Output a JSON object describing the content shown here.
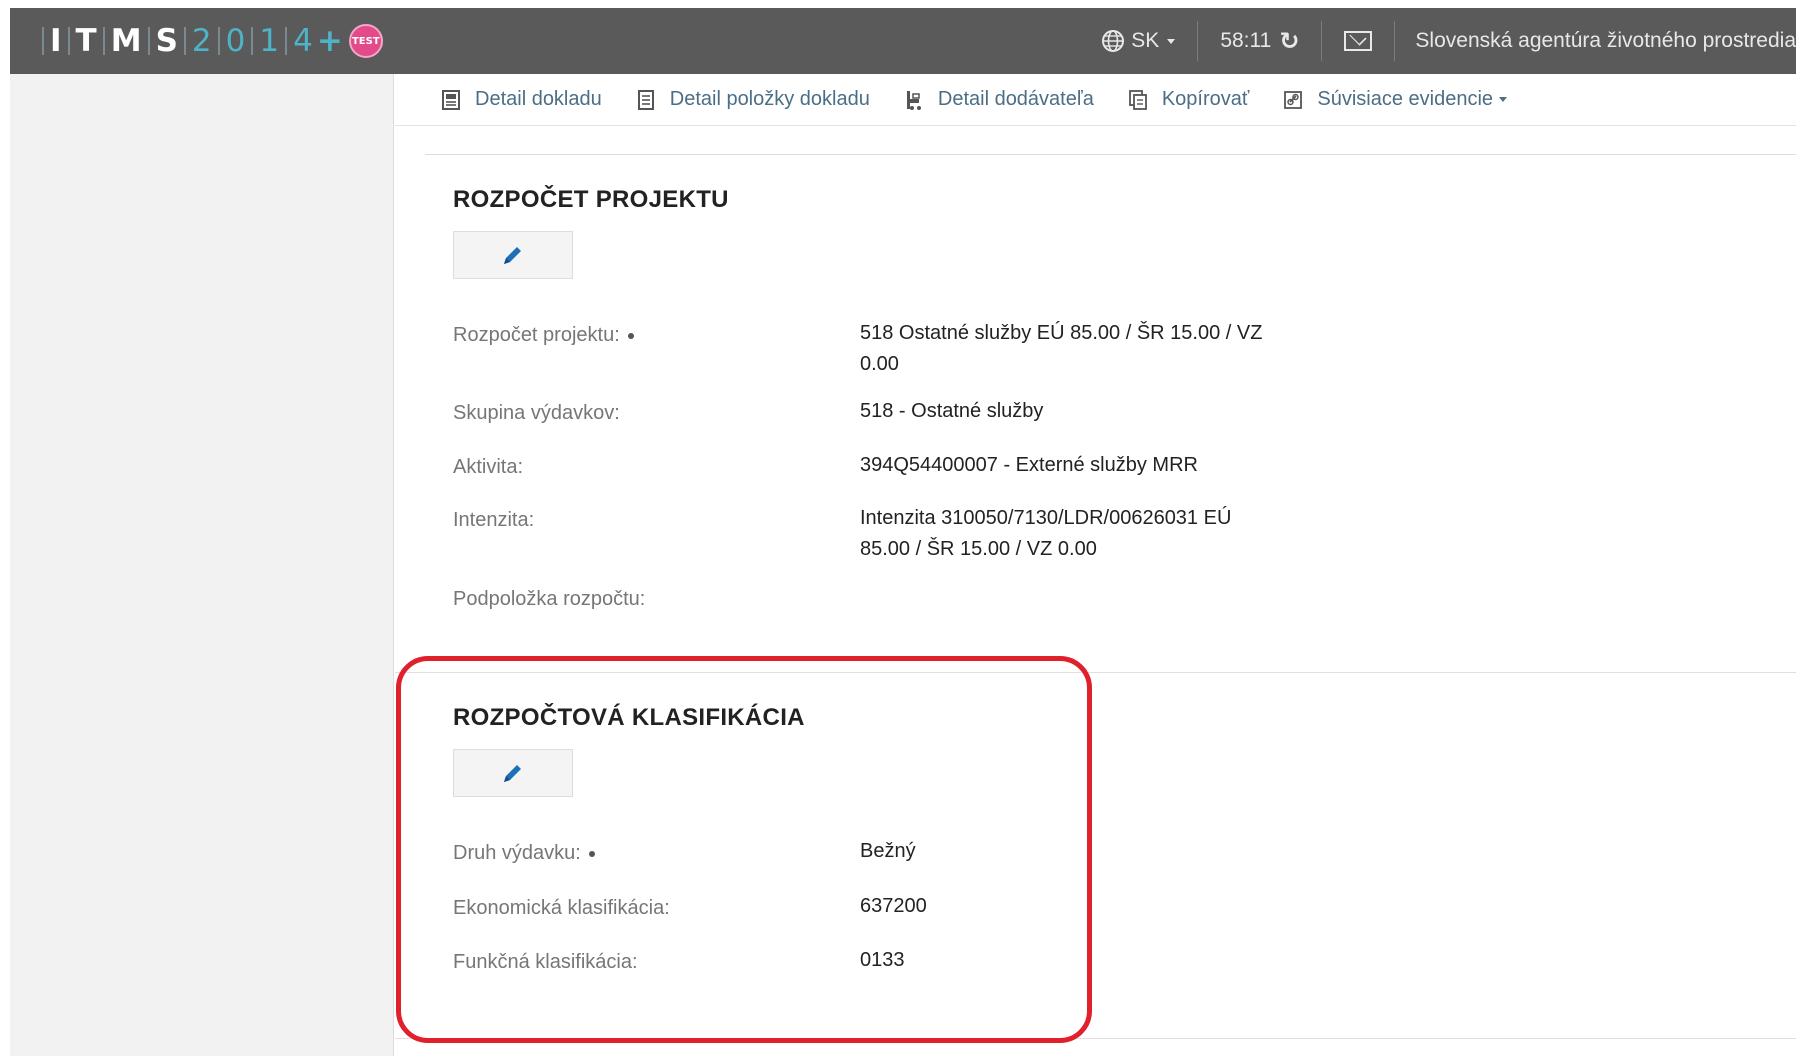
{
  "app": {
    "logo_letters": [
      "I",
      "T",
      "M",
      "S"
    ],
    "logo_digits": [
      "2",
      "0",
      "1",
      "4"
    ],
    "logo_plus": "+",
    "test_badge": "TEST"
  },
  "topbar": {
    "language": "SK",
    "timer": "58:11",
    "refresh_icon": "↻",
    "organization": "Slovenská agentúra životného prostredia"
  },
  "toolbar": {
    "items": [
      {
        "label": "Detail dokladu",
        "icon": "document-icon"
      },
      {
        "label": "Detail položky dokladu",
        "icon": "list-document-icon"
      },
      {
        "label": "Detail dodávateľa",
        "icon": "supplier-icon"
      },
      {
        "label": "Kopírovať",
        "icon": "copy-icon"
      },
      {
        "label": "Súvisiace evidencie",
        "icon": "link-icon"
      }
    ]
  },
  "budget_section": {
    "title": "ROZPOČET PROJEKTU",
    "rows": [
      {
        "label": "Rozpočet projektu:",
        "value_line1": "518 Ostatné služby EÚ 85.00 / ŠR 15.00 / VZ",
        "value_line2": "0.00"
      },
      {
        "label": "Skupina výdavkov:",
        "value_line1": "518 - Ostatné služby"
      },
      {
        "label": "Aktivita:",
        "value_line1": "394Q54400007 - Externé služby MRR"
      },
      {
        "label": "Intenzita:",
        "value_line1": "Intenzita 310050/7130/LDR/00626031 EÚ",
        "value_line2": "85.00 / ŠR 15.00 / VZ 0.00"
      },
      {
        "label": "Podpoložka rozpočtu:",
        "value_line1": ""
      }
    ]
  },
  "classification_section": {
    "title": "ROZPOČTOVÁ KLASIFIKÁCIA",
    "rows": [
      {
        "label": "Druh výdavku:",
        "value": "Bežný"
      },
      {
        "label": "Ekonomická klasifikácia:",
        "value": "637200"
      },
      {
        "label": "Funkčná klasifikácia:",
        "value": "0133"
      }
    ]
  },
  "colors": {
    "topbar_bg": "#5a5a5a",
    "logo_accent": "#4fb3c8",
    "link": "#4b6e86",
    "highlight": "#e0202a",
    "edit_icon": "#1d6fb8"
  }
}
